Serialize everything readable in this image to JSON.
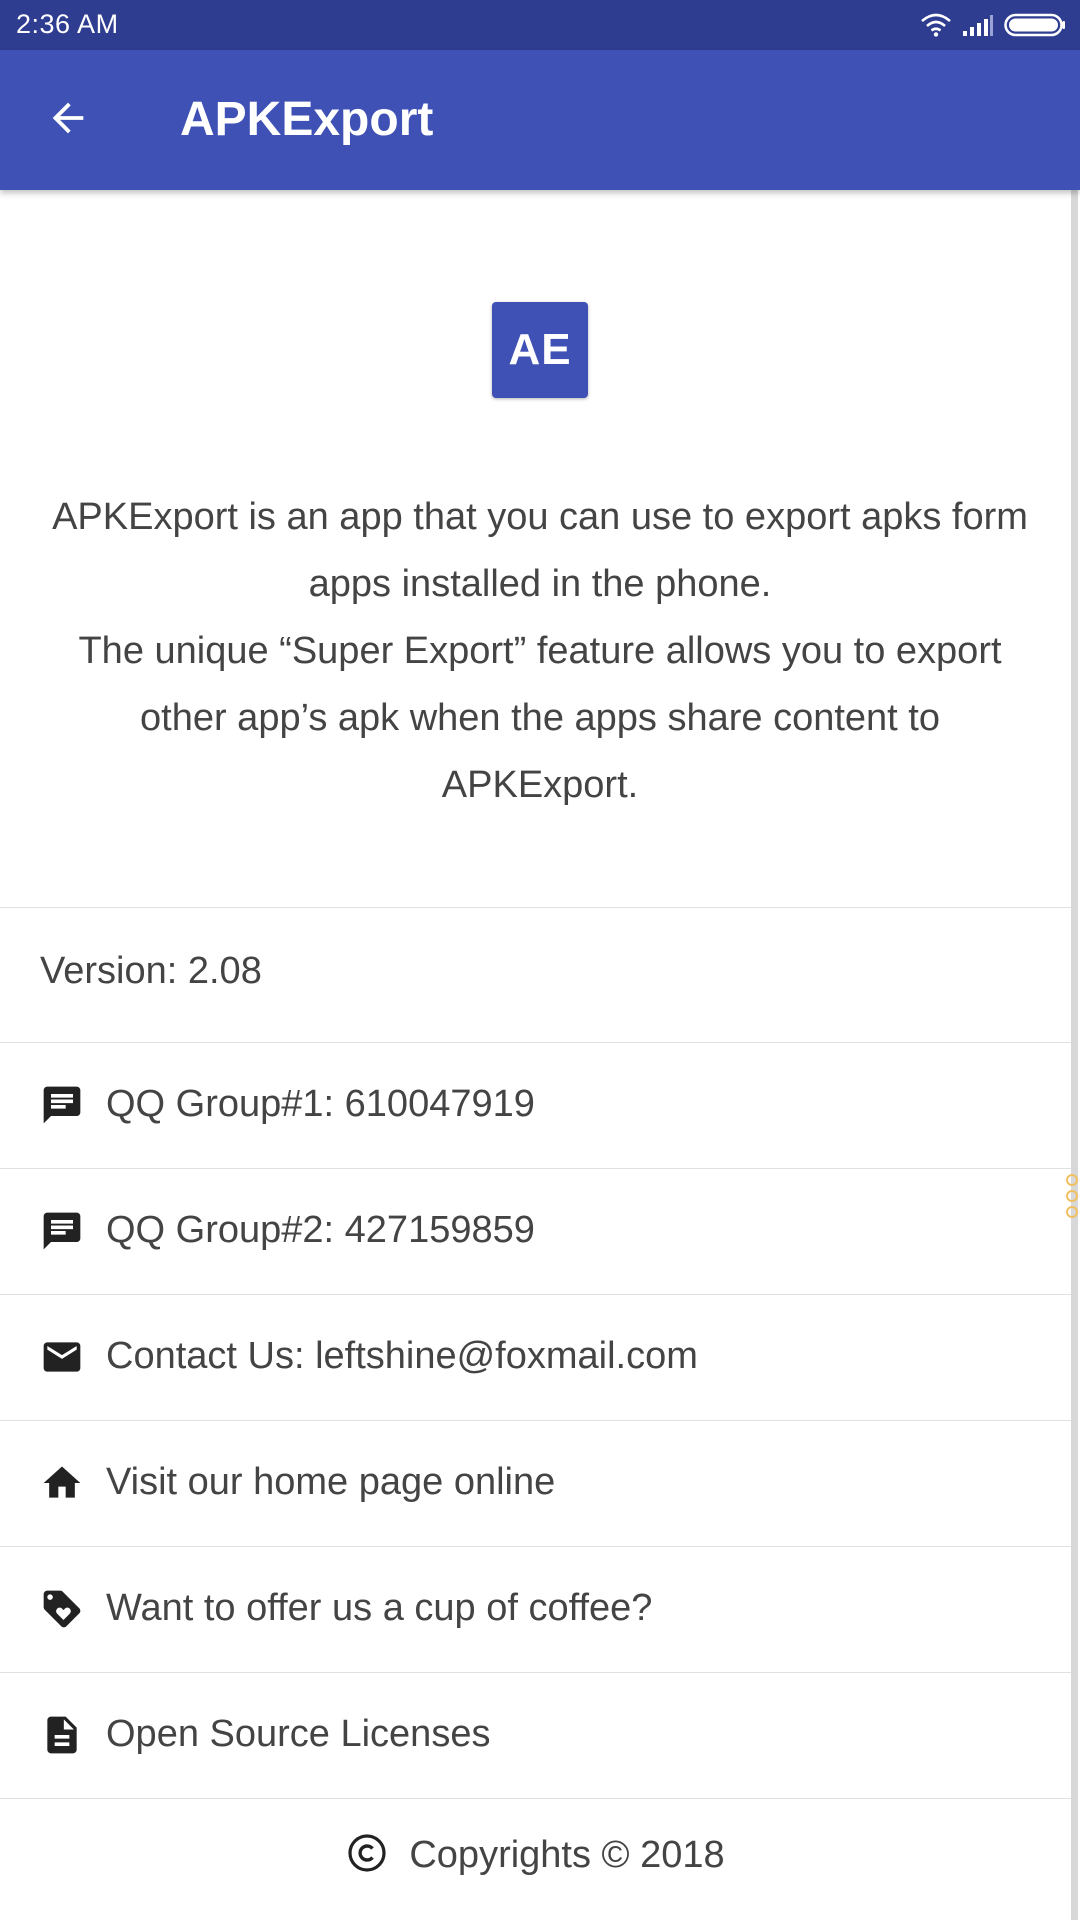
{
  "status_bar": {
    "time": "2:36 AM",
    "icons": [
      "wifi-icon",
      "signal-icon",
      "battery-icon"
    ]
  },
  "toolbar": {
    "back_icon": "arrow-back-icon",
    "title": "APKExport",
    "color": "#3f51b5"
  },
  "logo": {
    "text": "AE",
    "color": "#3f51b5"
  },
  "description": {
    "line1": "APKExport is an app that you can use to export apks form apps installed in the phone.",
    "line2": "The unique “Super Export” feature allows you to export other app’s apk when the apps share content to APKExport."
  },
  "version": {
    "text": "Version: 2.08"
  },
  "items": [
    {
      "icon": "chat-icon",
      "label": "QQ Group#1: 610047919"
    },
    {
      "icon": "chat-icon",
      "label": "QQ Group#2: 427159859"
    },
    {
      "icon": "mail-icon",
      "label": "Contact Us: leftshine@foxmail.com"
    },
    {
      "icon": "home-icon",
      "label": "Visit our home page online"
    },
    {
      "icon": "tag-heart-icon",
      "label": "Want to offer us a cup of coffee?"
    },
    {
      "icon": "document-icon",
      "label": "Open Source Licenses"
    }
  ],
  "footer": {
    "icon": "copyright-icon",
    "text": "Copyrights © 2018"
  }
}
